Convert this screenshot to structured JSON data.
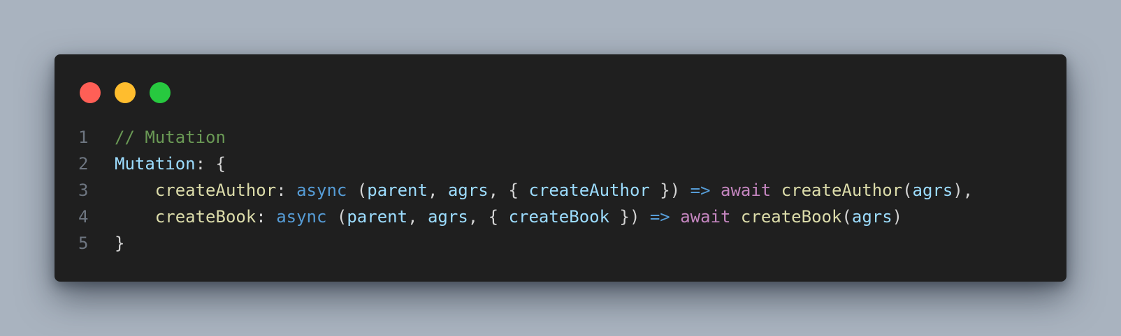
{
  "window": {
    "controls": [
      {
        "name": "close",
        "color": "#ff5f56"
      },
      {
        "name": "minimize",
        "color": "#ffbd2e"
      },
      {
        "name": "zoom",
        "color": "#27c93f"
      }
    ]
  },
  "code": {
    "lines": [
      {
        "number": "1",
        "tokens": [
          {
            "text": "// Mutation",
            "kind": "comment"
          }
        ]
      },
      {
        "number": "2",
        "tokens": [
          {
            "text": "Mutation",
            "kind": "prop"
          },
          {
            "text": ": {",
            "kind": "punc"
          }
        ]
      },
      {
        "number": "3",
        "tokens": [
          {
            "text": "    ",
            "kind": "punc"
          },
          {
            "text": "createAuthor",
            "kind": "fn"
          },
          {
            "text": ": ",
            "kind": "punc"
          },
          {
            "text": "async",
            "kind": "kw"
          },
          {
            "text": " (",
            "kind": "punc"
          },
          {
            "text": "parent",
            "kind": "var"
          },
          {
            "text": ", ",
            "kind": "punc"
          },
          {
            "text": "agrs",
            "kind": "var"
          },
          {
            "text": ", { ",
            "kind": "punc"
          },
          {
            "text": "createAuthor",
            "kind": "var"
          },
          {
            "text": " }) ",
            "kind": "punc"
          },
          {
            "text": "=>",
            "kind": "op"
          },
          {
            "text": " ",
            "kind": "punc"
          },
          {
            "text": "await",
            "kind": "ctrl"
          },
          {
            "text": " ",
            "kind": "punc"
          },
          {
            "text": "createAuthor",
            "kind": "fn"
          },
          {
            "text": "(",
            "kind": "punc"
          },
          {
            "text": "agrs",
            "kind": "var"
          },
          {
            "text": "),",
            "kind": "punc"
          }
        ]
      },
      {
        "number": "4",
        "tokens": [
          {
            "text": "    ",
            "kind": "punc"
          },
          {
            "text": "createBook",
            "kind": "fn"
          },
          {
            "text": ": ",
            "kind": "punc"
          },
          {
            "text": "async",
            "kind": "kw"
          },
          {
            "text": " (",
            "kind": "punc"
          },
          {
            "text": "parent",
            "kind": "var"
          },
          {
            "text": ", ",
            "kind": "punc"
          },
          {
            "text": "agrs",
            "kind": "var"
          },
          {
            "text": ", { ",
            "kind": "punc"
          },
          {
            "text": "createBook",
            "kind": "var"
          },
          {
            "text": " }) ",
            "kind": "punc"
          },
          {
            "text": "=>",
            "kind": "op"
          },
          {
            "text": " ",
            "kind": "punc"
          },
          {
            "text": "await",
            "kind": "ctrl"
          },
          {
            "text": " ",
            "kind": "punc"
          },
          {
            "text": "createBook",
            "kind": "fn"
          },
          {
            "text": "(",
            "kind": "punc"
          },
          {
            "text": "agrs",
            "kind": "var"
          },
          {
            "text": ")",
            "kind": "punc"
          }
        ]
      },
      {
        "number": "5",
        "tokens": [
          {
            "text": "}",
            "kind": "punc"
          }
        ]
      }
    ]
  }
}
